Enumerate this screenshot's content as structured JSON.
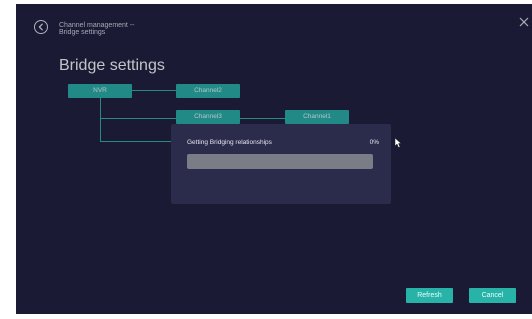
{
  "header": {
    "breadcrumb": "Channel management --\nBridge settings",
    "title": "Bridge settings"
  },
  "topology": {
    "root": "NVR",
    "channels": [
      "Channel2",
      "Channel3",
      "Channel1"
    ]
  },
  "dialog": {
    "message": "Getting Bridging relationships",
    "percent_text": "0%",
    "progress": 0
  },
  "buttons": {
    "refresh": "Refresh",
    "cancel": "Cancel"
  },
  "colors": {
    "panel_bg": "#1e1e3a",
    "accent": "#27b3a8",
    "dialog_bg": "#2b2b4b",
    "progress_track": "#7a7d86"
  },
  "icons": {
    "back": "chevron-left-circle-icon",
    "close": "close-icon",
    "cursor": "mouse-pointer-icon"
  }
}
